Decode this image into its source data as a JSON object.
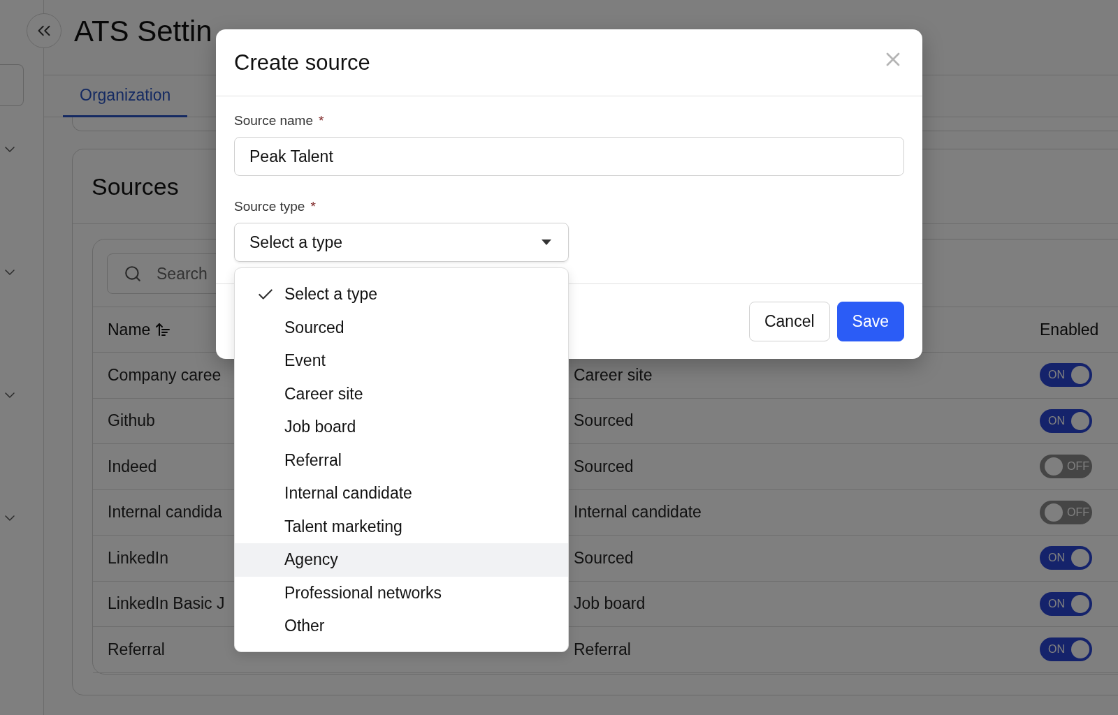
{
  "sidebar": {
    "groups": [
      {
        "expanded": false
      },
      {
        "expanded": false
      },
      {
        "expanded": false
      },
      {
        "expanded": false
      }
    ]
  },
  "page": {
    "title": "ATS Settin",
    "tabs": [
      {
        "label": "Organization",
        "selected": true
      }
    ]
  },
  "sources": {
    "title": "Sources",
    "search": {
      "placeholder": "Search"
    },
    "name_column": {
      "label": "Name",
      "sorted": true
    },
    "enabled_column": "Enabled",
    "rows": [
      {
        "name": "Company caree",
        "type": "Career site",
        "enabled": true,
        "toggle_label": "ON"
      },
      {
        "name": "Github",
        "type": "Sourced",
        "enabled": true,
        "toggle_label": "ON"
      },
      {
        "name": "Indeed",
        "type": "Sourced",
        "enabled": false,
        "toggle_label": "OFF"
      },
      {
        "name": "Internal candida",
        "type": "Internal candidate",
        "enabled": false,
        "toggle_label": "OFF"
      },
      {
        "name": "LinkedIn",
        "type": "Sourced",
        "enabled": true,
        "toggle_label": "ON"
      },
      {
        "name": "LinkedIn Basic J",
        "type": "Job board",
        "enabled": true,
        "toggle_label": "ON"
      },
      {
        "name": "Referral",
        "type": "Referral",
        "enabled": true,
        "toggle_label": "ON"
      }
    ]
  },
  "modal": {
    "title": "Create source",
    "source_name": {
      "label": "Source name",
      "required_mark": "*",
      "value": "Peak Talent"
    },
    "source_type": {
      "label": "Source type",
      "required_mark": "*",
      "value": "Select a type",
      "expanded": true,
      "options": [
        {
          "label": "Select a type",
          "selected": true,
          "highlighted": false
        },
        {
          "label": "Sourced",
          "selected": false,
          "highlighted": false
        },
        {
          "label": "Event",
          "selected": false,
          "highlighted": false
        },
        {
          "label": "Career site",
          "selected": false,
          "highlighted": false
        },
        {
          "label": "Job board",
          "selected": false,
          "highlighted": false
        },
        {
          "label": "Referral",
          "selected": false,
          "highlighted": false
        },
        {
          "label": "Internal candidate",
          "selected": false,
          "highlighted": false
        },
        {
          "label": "Talent marketing",
          "selected": false,
          "highlighted": false
        },
        {
          "label": "Agency",
          "selected": false,
          "highlighted": true
        },
        {
          "label": "Professional networks",
          "selected": false,
          "highlighted": false
        },
        {
          "label": "Other",
          "selected": false,
          "highlighted": false
        }
      ]
    },
    "buttons": [
      {
        "label": "Cancel",
        "kind": "secondary"
      },
      {
        "label": "Save",
        "kind": "primary"
      }
    ]
  }
}
